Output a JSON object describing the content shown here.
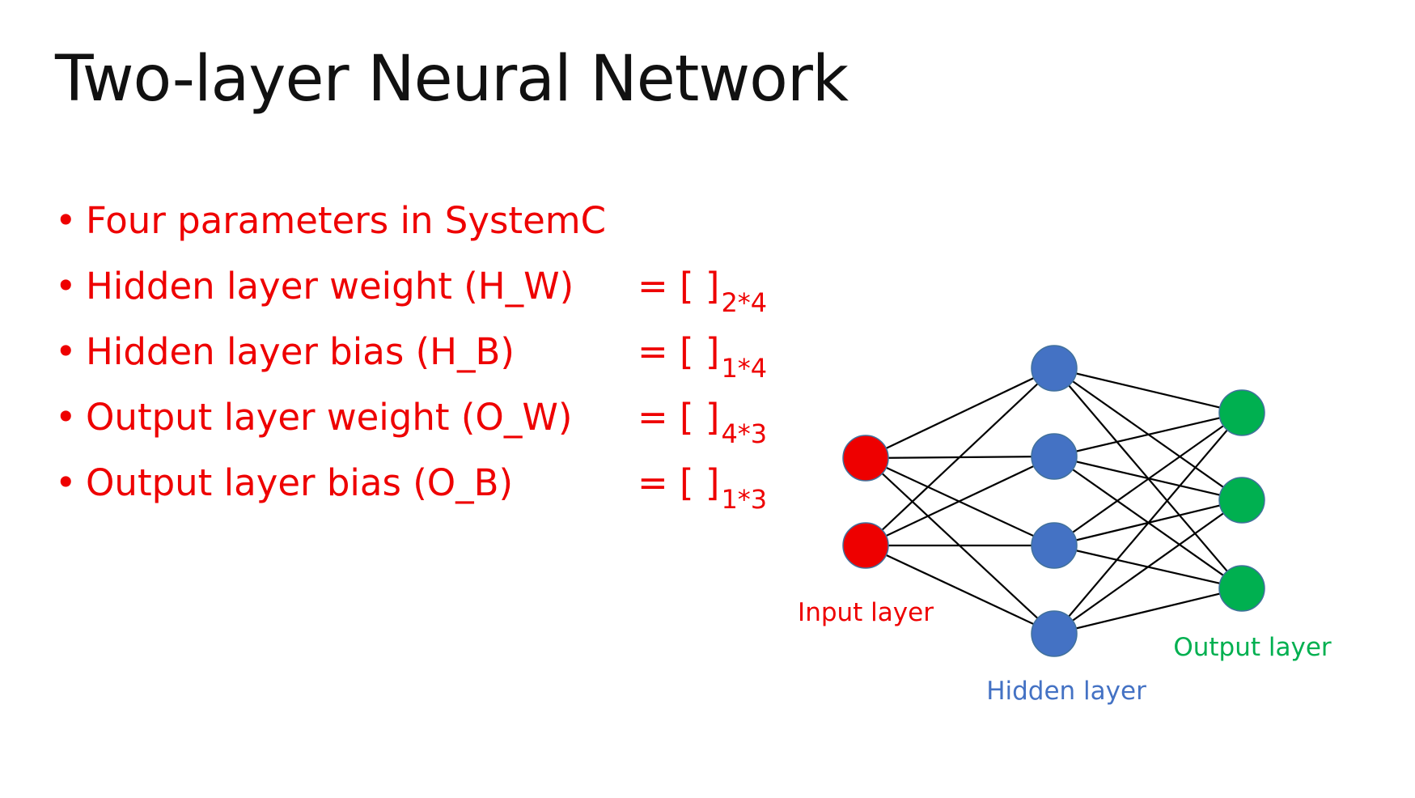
{
  "slide": {
    "title": "Two-layer Neural Network"
  },
  "bullets": [
    {
      "text": "Four parameters in SystemC",
      "eq": "",
      "dim": ""
    },
    {
      "text": "Hidden layer weight (H_W)",
      "eq": "= [  ]",
      "dim": "2*4"
    },
    {
      "text": "Hidden layer bias (H_B)",
      "eq": "= [  ]",
      "dim": "1*4"
    },
    {
      "text": "Output layer weight (O_W)",
      "eq": "= [  ]",
      "dim": "4*3"
    },
    {
      "text": "Output layer bias (O_B)",
      "eq": "= [  ]",
      "dim": "1*3"
    }
  ],
  "network": {
    "layers": [
      {
        "label": "Input layer",
        "nodes": 2,
        "color": "#ee0000",
        "label_color": "#ee0000"
      },
      {
        "label": "Hidden layer",
        "nodes": 4,
        "color": "#4472c4",
        "label_color": "#4472c4"
      },
      {
        "label": "Output layer",
        "nodes": 3,
        "color": "#00b050",
        "label_color": "#00b050"
      }
    ],
    "edge_color": "#000000",
    "node_stroke": "#41719c"
  }
}
